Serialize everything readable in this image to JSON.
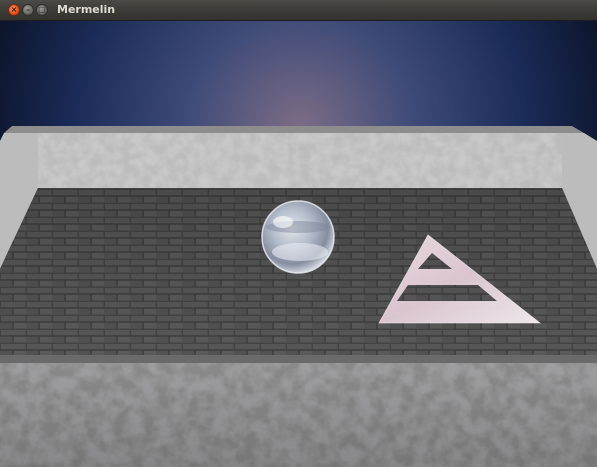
{
  "window": {
    "title": "Mermelin",
    "close_glyph": "×",
    "minimize_glyph": "–",
    "maximize_glyph": "□"
  },
  "scene": {
    "sky_colors": [
      "#0c1428",
      "#24386a",
      "#7d6d86"
    ],
    "wall_color": "#c9c9c9",
    "floor_color": "#4b4b4b",
    "ball": {
      "name": "glass-ball",
      "color": "#c9d4e6"
    },
    "goal": {
      "name": "triangle-goal",
      "color": "#eedbe0"
    }
  }
}
